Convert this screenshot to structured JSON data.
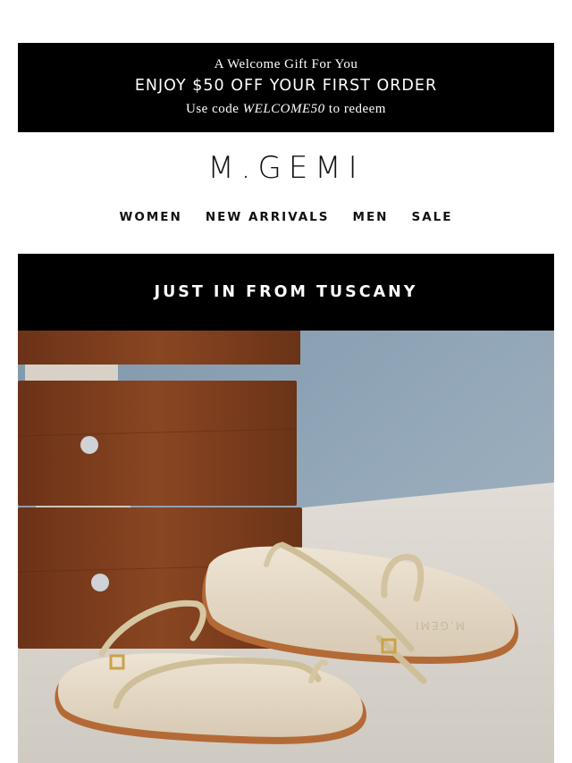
{
  "promo": {
    "eyebrow": "A Welcome Gift For You",
    "headline": "ENJOY $50 OFF YOUR FIRST ORDER",
    "code_prefix": "Use code ",
    "code": "WELCOME50",
    "code_suffix": " to redeem"
  },
  "brand": {
    "logo": "M.GEMI",
    "shoe_stamp": "M.GEMI"
  },
  "nav": {
    "items": [
      "WOMEN",
      "NEW ARRIVALS",
      "MEN",
      "SALE"
    ]
  },
  "hero": {
    "banner": "JUST IN FROM TUSCANY",
    "image_subject": "sandals-product-photo"
  },
  "colors": {
    "promo_bg": "#000000",
    "text_light": "#ffffff",
    "text_dark": "#111111",
    "wood": "#7a3f1e",
    "sole": "#e9dcc9",
    "strap": "#d9ccaa"
  }
}
